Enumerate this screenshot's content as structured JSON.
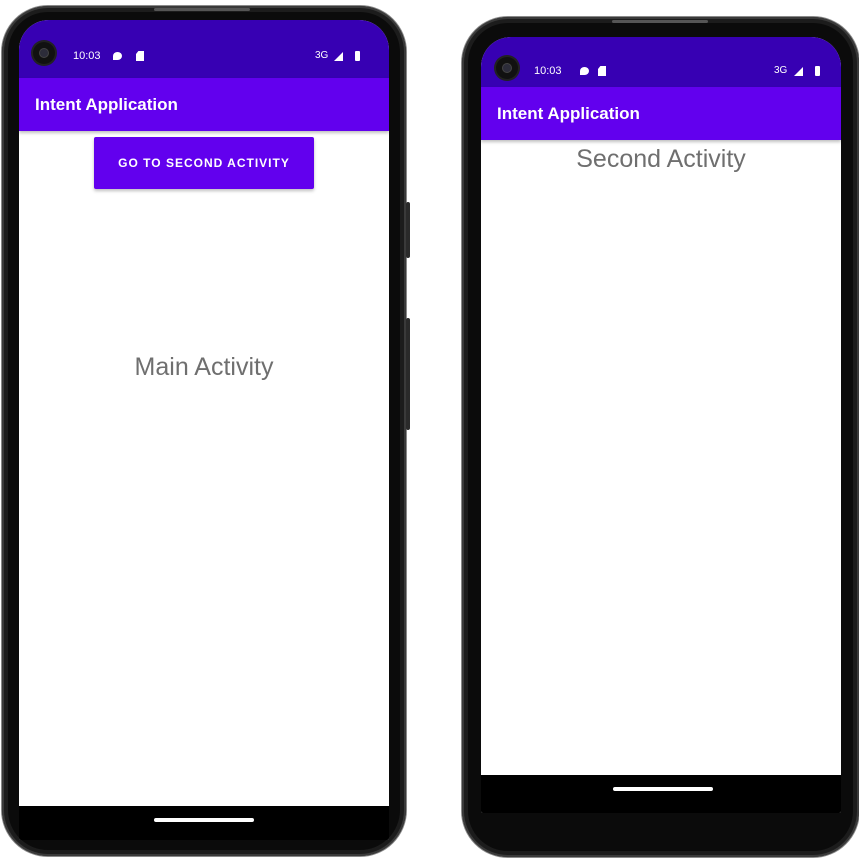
{
  "colors": {
    "status_bar": "#3700b3",
    "app_bar": "#6200ee",
    "button": "#6200ee",
    "activity_text": "#6f6f6f",
    "screen_background": "#ffffff"
  },
  "screens": [
    {
      "status_bar": {
        "time": "10:03",
        "network": "3G",
        "icons": [
          "notification-icon",
          "sd-card-icon",
          "signal-icon",
          "battery-icon"
        ]
      },
      "app_bar": {
        "title": "Intent Application"
      },
      "button": {
        "label": "GO TO SECOND ACTIVITY"
      },
      "content": {
        "text": "Main Activity"
      }
    },
    {
      "status_bar": {
        "time": "10:03",
        "network": "3G",
        "icons": [
          "notification-icon",
          "sd-card-icon",
          "signal-icon",
          "battery-icon"
        ]
      },
      "app_bar": {
        "title": "Intent Application"
      },
      "content": {
        "text": "Second Activity"
      }
    }
  ]
}
